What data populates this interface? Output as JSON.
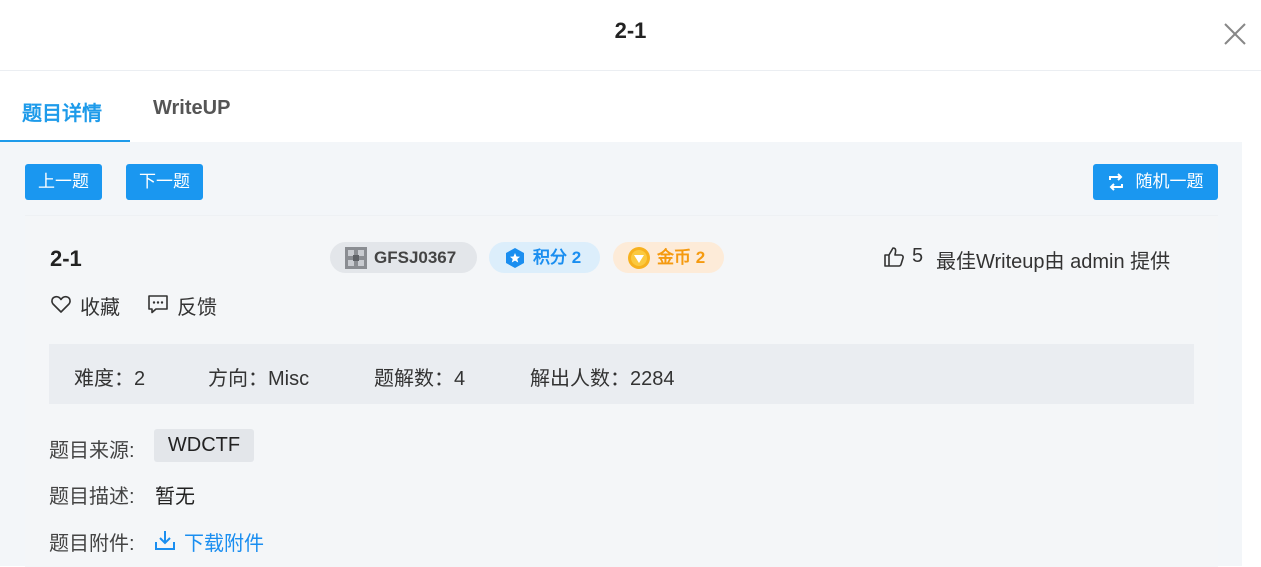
{
  "header": {
    "title": "2-1"
  },
  "tabs": [
    {
      "label": "题目详情",
      "active": true
    },
    {
      "label": "WriteUP",
      "active": false
    }
  ],
  "nav": {
    "prev_label": "上一题",
    "next_label": "下一题",
    "random_label": "随机一题"
  },
  "question": {
    "title": "2-1",
    "id_badge": "GFSJ0367",
    "score_badge": "积分 2",
    "gold_badge": "金币 2",
    "likes": "5",
    "best_writeup": "最佳Writeup由 admin 提供",
    "favorite_label": "收藏",
    "feedback_label": "反馈"
  },
  "stats": {
    "difficulty": "难度：2",
    "category": "方向：Misc",
    "solutions": "题解数：4",
    "solvers": "解出人数：2284"
  },
  "info": {
    "source_label": "题目来源:",
    "source_value": "WDCTF",
    "desc_label": "题目描述:",
    "desc_value": "暂无",
    "attach_label": "题目附件:",
    "download_label": "下载附件"
  },
  "colors": {
    "accent": "#1a97f0",
    "gold": "#f59a0f"
  }
}
